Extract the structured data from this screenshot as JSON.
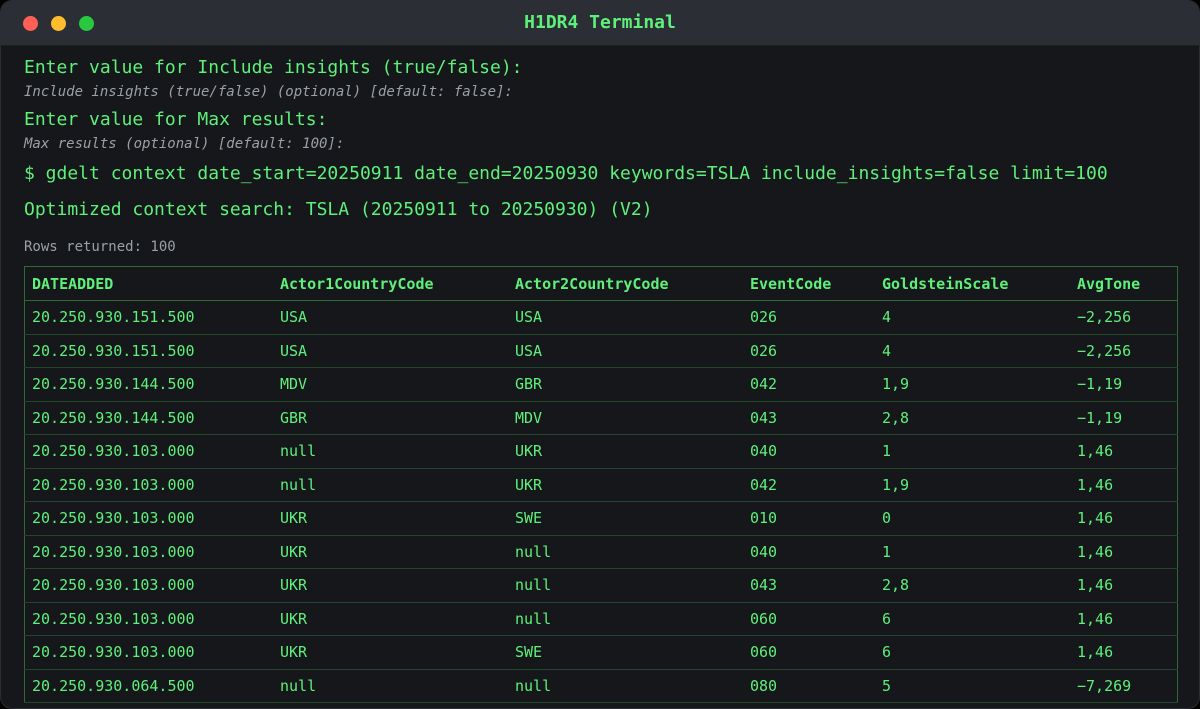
{
  "window": {
    "title": "H1DR4 Terminal"
  },
  "terminal": {
    "prompt1": "Enter value for Include insights (true/false):",
    "hint1": "Include insights (true/false) (optional) [default: false]:",
    "prompt2": "Enter value for Max results:",
    "hint2": "Max results (optional) [default: 100]:",
    "command": "$ gdelt context date_start=20250911 date_end=20250930 keywords=TSLA include_insights=false limit=100",
    "info": "Optimized context search: TSLA (20250911 to 20250930) (V2)",
    "rows_returned": "Rows returned: 100"
  },
  "table": {
    "headers": [
      "DATEADDED",
      "Actor1CountryCode",
      "Actor2CountryCode",
      "EventCode",
      "GoldsteinScale",
      "AvgTone"
    ],
    "rows": [
      [
        "20.250.930.151.500",
        "USA",
        "USA",
        "026",
        "4",
        "−2,256"
      ],
      [
        "20.250.930.151.500",
        "USA",
        "USA",
        "026",
        "4",
        "−2,256"
      ],
      [
        "20.250.930.144.500",
        "MDV",
        "GBR",
        "042",
        "1,9",
        "−1,19"
      ],
      [
        "20.250.930.144.500",
        "GBR",
        "MDV",
        "043",
        "2,8",
        "−1,19"
      ],
      [
        "20.250.930.103.000",
        "null",
        "UKR",
        "040",
        "1",
        "1,46"
      ],
      [
        "20.250.930.103.000",
        "null",
        "UKR",
        "042",
        "1,9",
        "1,46"
      ],
      [
        "20.250.930.103.000",
        "UKR",
        "SWE",
        "010",
        "0",
        "1,46"
      ],
      [
        "20.250.930.103.000",
        "UKR",
        "null",
        "040",
        "1",
        "1,46"
      ],
      [
        "20.250.930.103.000",
        "UKR",
        "null",
        "043",
        "2,8",
        "1,46"
      ],
      [
        "20.250.930.103.000",
        "UKR",
        "null",
        "060",
        "6",
        "1,46"
      ],
      [
        "20.250.930.103.000",
        "UKR",
        "SWE",
        "060",
        "6",
        "1,46"
      ],
      [
        "20.250.930.064.500",
        "null",
        "null",
        "080",
        "5",
        "−7,269"
      ]
    ]
  },
  "colors": {
    "accent": "#5ef07a",
    "background": "#15171b",
    "muted": "#9aa0a6"
  }
}
